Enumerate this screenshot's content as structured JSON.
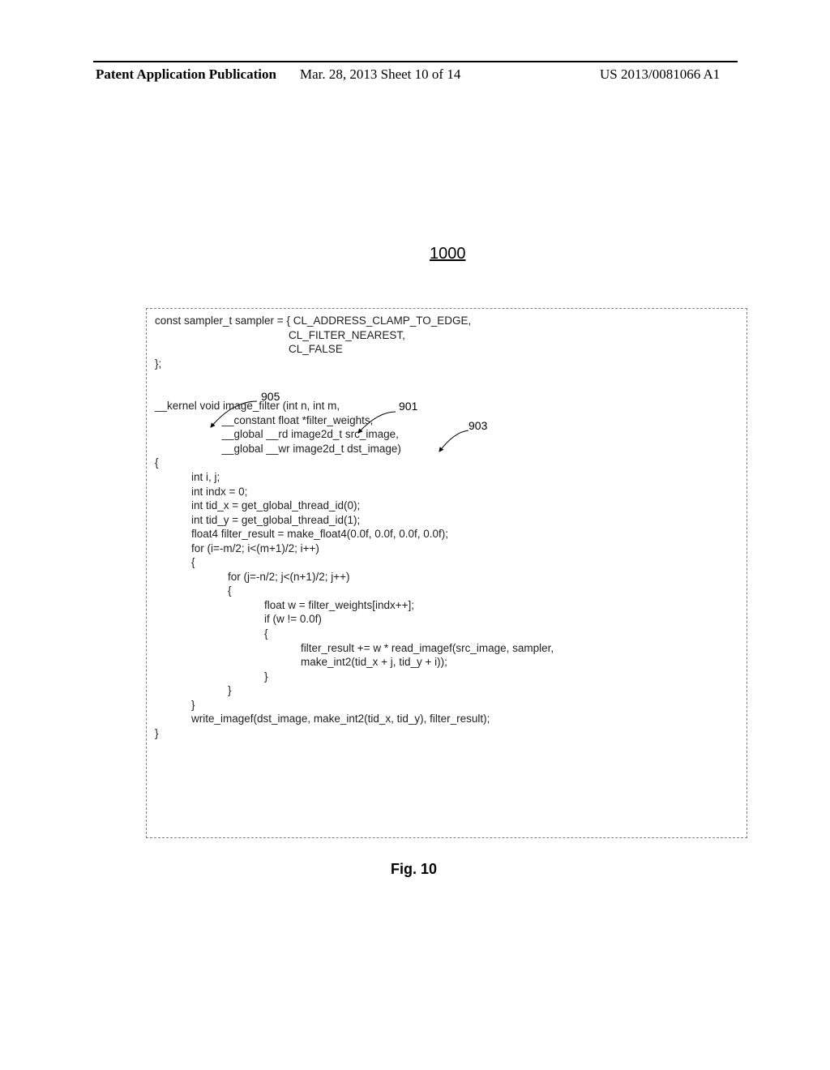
{
  "header": {
    "left": "Patent Application Publication",
    "middle": "Mar. 28, 2013  Sheet 10 of 14",
    "right": "US 2013/0081066 A1"
  },
  "figure": {
    "number": "1000",
    "caption": "Fig. 10"
  },
  "callouts": {
    "a": "905",
    "b": "901",
    "c": "903"
  },
  "code": {
    "l01": "const sampler_t sampler = { CL_ADDRESS_CLAMP_TO_EDGE,",
    "l02": "                                            CL_FILTER_NEAREST,",
    "l03": "                                            CL_FALSE",
    "l04": "};",
    "l05": "",
    "l06": "",
    "l07": "__kernel void image_filter (int n, int m,",
    "l08": "                      __constant float *filter_weights,",
    "l09": "                      __global __rd image2d_t src_image,",
    "l10": "                      __global __wr image2d_t dst_image)",
    "l11": "{",
    "l12": "            int i, j;",
    "l13": "            int indx = 0;",
    "l14": "            int tid_x = get_global_thread_id(0);",
    "l15": "            int tid_y = get_global_thread_id(1);",
    "l16": "            float4 filter_result = make_float4(0.0f, 0.0f, 0.0f, 0.0f);",
    "l17": "            for (i=-m/2; i<(m+1)/2; i++)",
    "l18": "            {",
    "l19": "                        for (j=-n/2; j<(n+1)/2; j++)",
    "l20": "                        {",
    "l21": "                                    float w = filter_weights[indx++];",
    "l22": "                                    if (w != 0.0f)",
    "l23": "                                    {",
    "l24": "                                                filter_result += w * read_imagef(src_image, sampler,",
    "l25": "                                                make_int2(tid_x + j, tid_y + i));",
    "l26": "                                    }",
    "l27": "                        }",
    "l28": "            }",
    "l29": "            write_imagef(dst_image, make_int2(tid_x, tid_y), filter_result);",
    "l30": "}"
  }
}
